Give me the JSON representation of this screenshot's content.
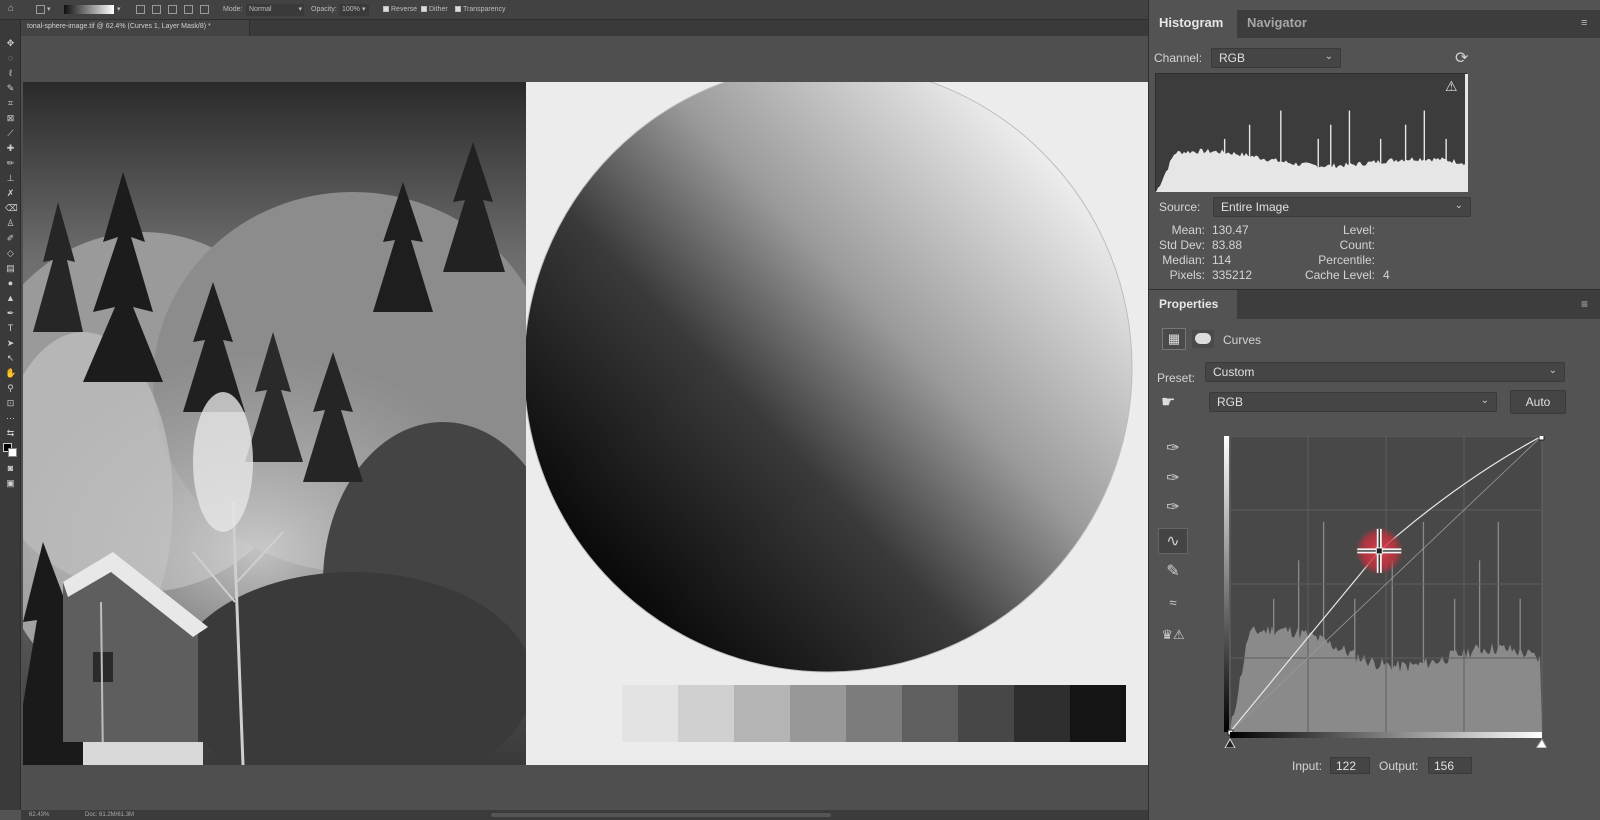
{
  "options_bar": {
    "mode_label": "Mode:",
    "mode_value": "Normal",
    "opacity_label": "Opacity:",
    "opacity_value": "100%",
    "reverse_label": "Reverse",
    "dither_label": "Dither",
    "transparency_label": "Transparency"
  },
  "document": {
    "tab_title": "tonal-sphere-image.tif @ 62.4% (Curves 1, Layer Mask/8) *",
    "zoom_status": "62.43%",
    "doc_status": "Doc: 61.2M/61.3M",
    "swatches": [
      "#e3e3e3",
      "#d0d0d0",
      "#b4b4b4",
      "#989898",
      "#7c7c7c",
      "#5f5f5f",
      "#474747",
      "#2e2e2e",
      "#141414"
    ]
  },
  "histogram_panel": {
    "tab_histogram": "Histogram",
    "tab_navigator": "Navigator",
    "channel_label": "Channel:",
    "channel_value": "RGB",
    "source_label": "Source:",
    "source_value": "Entire Image",
    "stats_left": [
      {
        "label": "Mean:",
        "value": "130.47"
      },
      {
        "label": "Std Dev:",
        "value": "83.88"
      },
      {
        "label": "Median:",
        "value": "114"
      },
      {
        "label": "Pixels:",
        "value": "335212"
      }
    ],
    "stats_right": [
      {
        "label": "Level:",
        "value": ""
      },
      {
        "label": "Count:",
        "value": ""
      },
      {
        "label": "Percentile:",
        "value": ""
      },
      {
        "label": "Cache Level:",
        "value": "4"
      }
    ]
  },
  "properties_panel": {
    "title": "Properties",
    "adjustment_name": "Curves",
    "preset_label": "Preset:",
    "preset_value": "Custom",
    "channel_value": "RGB",
    "auto_label": "Auto",
    "input_label": "Input:",
    "input_value": "122",
    "output_label": "Output:",
    "output_value": "156"
  },
  "colors": {
    "accent_red": "#d0303c",
    "panel_bg": "#535353",
    "canvas_doc": "#ececec"
  }
}
